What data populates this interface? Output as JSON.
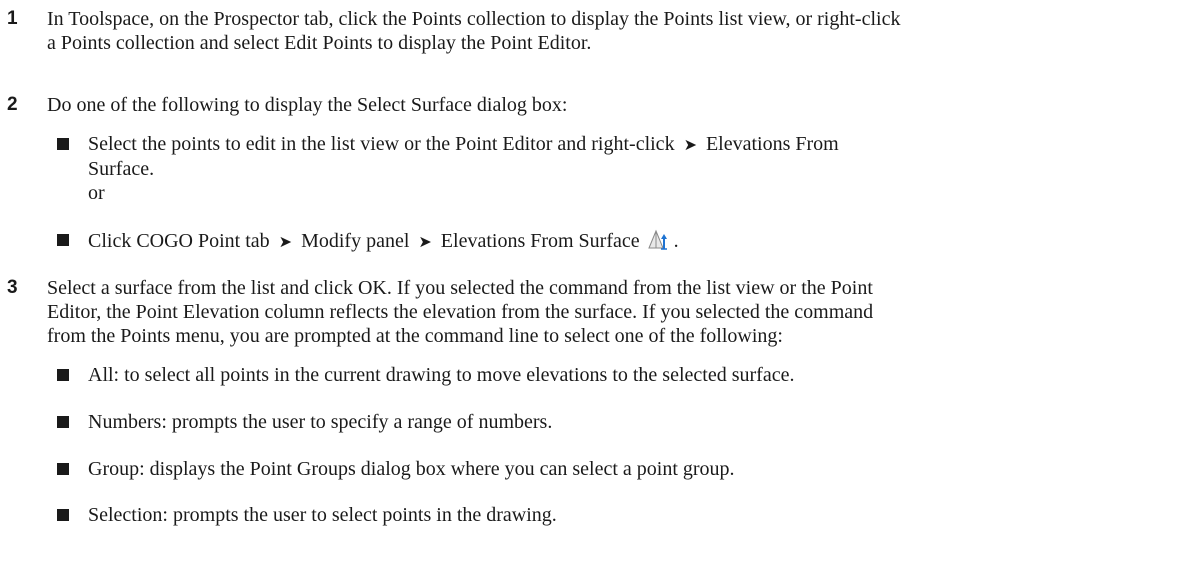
{
  "steps": [
    {
      "number": "1",
      "line1": "In Toolspace, on the Prospector tab, click the Points collection to display the Points list view, or right-click",
      "line2": "a Points collection and select Edit Points to display the Point Editor."
    },
    {
      "number": "2",
      "text": "Do one of the following to display the Select Surface dialog box:",
      "bullets": [
        {
          "line1_a": "Select the points to edit in the list view or the Point Editor and right-click",
          "arrow": "➤",
          "line1_b": "Elevations From",
          "line2": "Surface.",
          "line3": "or"
        },
        {
          "part1": "Click COGO Point tab",
          "arrow1": "➤",
          "part2": "Modify panel",
          "arrow2": "➤",
          "part3": "Elevations From Surface",
          "icon": "elevations-from-surface-icon",
          "suffix": "."
        }
      ]
    },
    {
      "number": "3",
      "line1": "Select a surface from the list and click OK. If you selected the command from the list view or the Point",
      "line2": "Editor, the Point Elevation column reflects the elevation from the surface. If you selected the command",
      "line3": "from the Points menu, you are prompted at the command line to select one of the following:",
      "bullets": [
        "All: to select all points in the current drawing to move elevations to the selected surface.",
        "Numbers: prompts the user to specify a range of numbers.",
        "Group: displays the Point Groups dialog box where you can select a point group.",
        "Selection: prompts the user to select points in the drawing."
      ]
    }
  ]
}
